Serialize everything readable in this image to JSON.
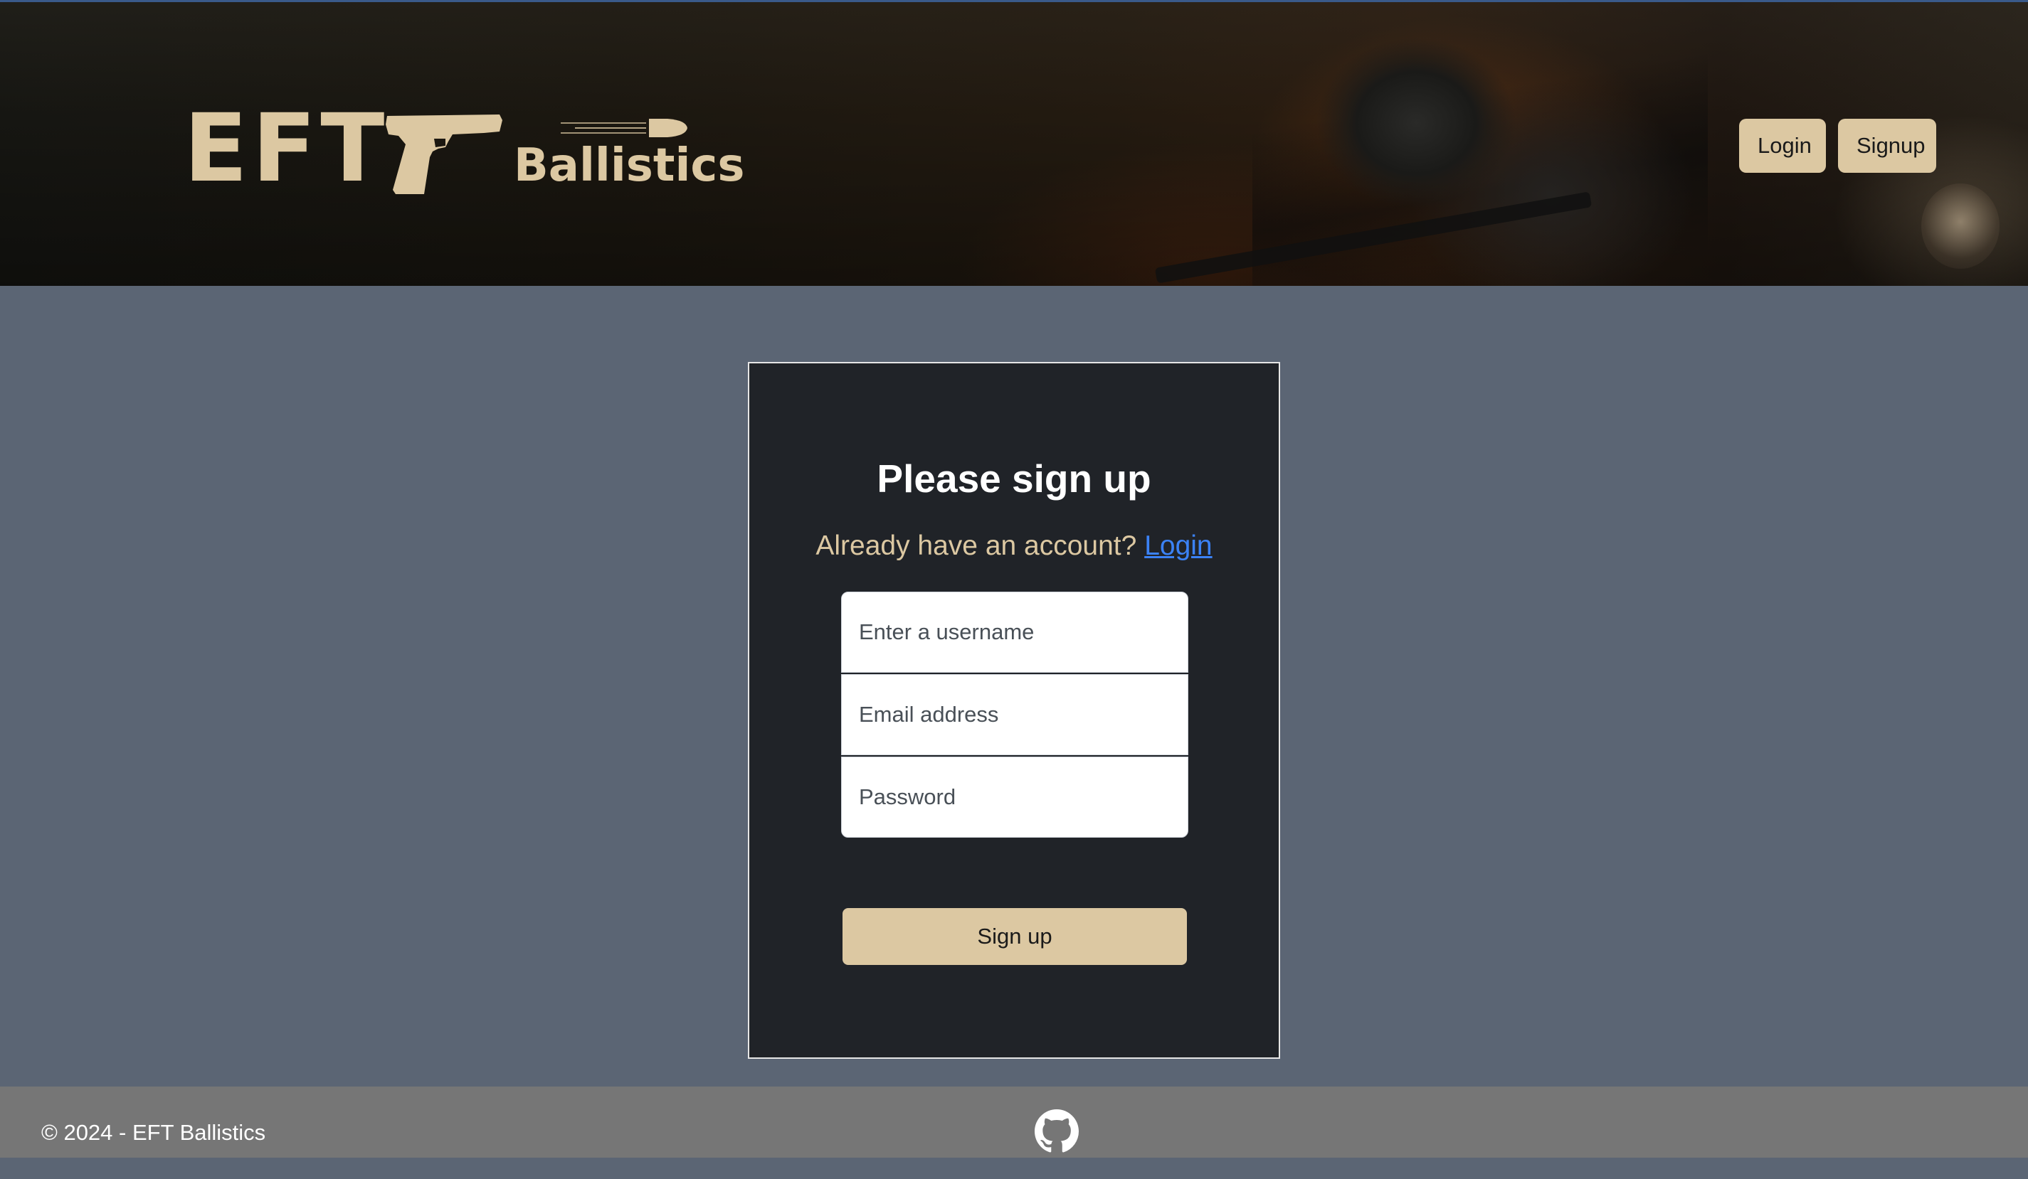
{
  "header": {
    "logo": {
      "wordmark": "EFT",
      "subtitle": "Ballistics",
      "gun_icon": "pistol-icon",
      "bullet_icon": "bullet-icon"
    },
    "nav": {
      "login_label": "Login",
      "signup_label": "Signup"
    }
  },
  "form": {
    "title": "Please sign up",
    "subtitle_prefix": "Already have an account?",
    "login_link": "Login",
    "username_placeholder": "Enter a username",
    "email_placeholder": "Email address",
    "password_placeholder": "Password",
    "submit_label": "Sign up"
  },
  "footer": {
    "copyright": "© 2024 - EFT Ballistics",
    "github_icon": "github-icon"
  },
  "colors": {
    "accent": "#dcc8a2",
    "page_background": "#5b6574",
    "card_background": "#202328",
    "footer_background": "#767676",
    "link": "#3b82f6"
  }
}
